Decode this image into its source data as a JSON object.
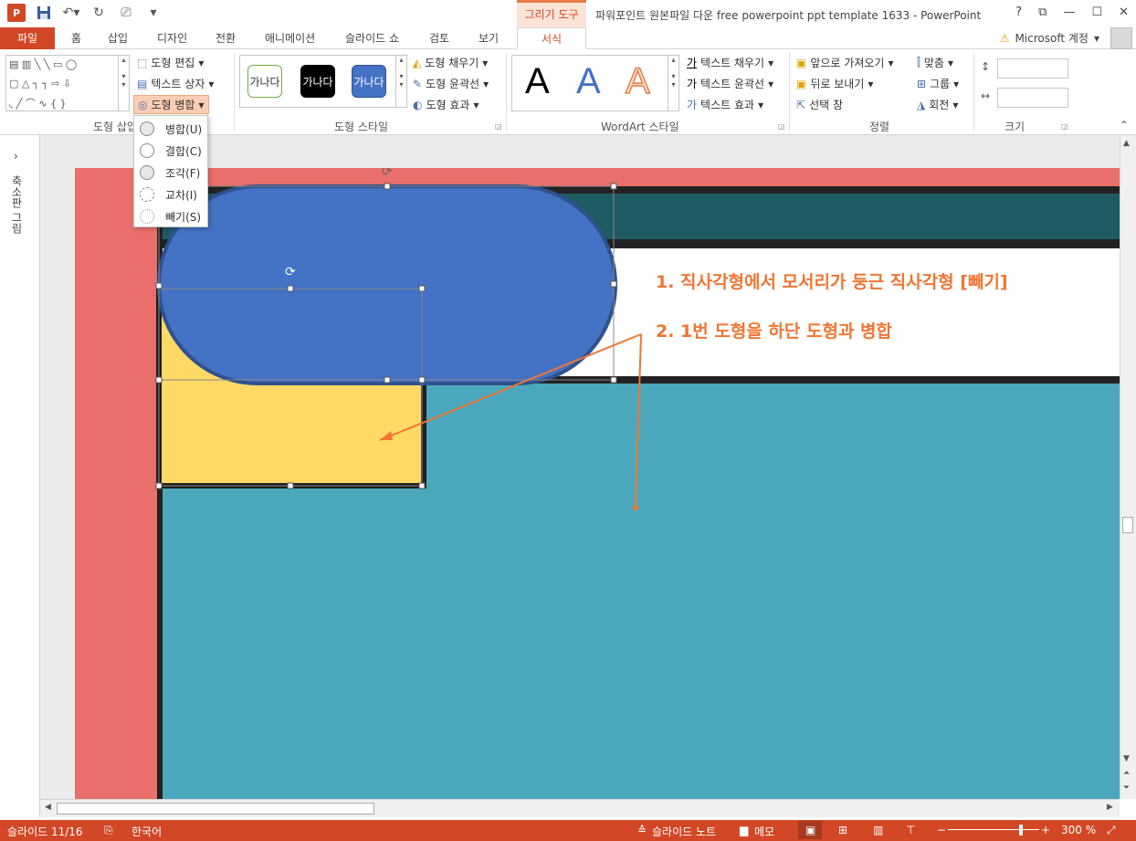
{
  "titlebar": {
    "drawing_tools": "그리기 도구",
    "window_title": "파워포인트 원본파일 다운 free powerpoint ppt template 1633 - PowerPoint",
    "help": "?",
    "restore": "⧉",
    "minimize": "—",
    "maximize": "☐",
    "close": "✕"
  },
  "tabs": {
    "file": "파일",
    "items": [
      "홈",
      "삽입",
      "디자인",
      "전환",
      "애니메이션",
      "슬라이드 쇼",
      "검토",
      "보기"
    ],
    "active": "서식",
    "account": "Microsoft 계정"
  },
  "ribbon": {
    "insert_shapes": {
      "label": "도형 삽입",
      "edit_shape": "도형 편집",
      "text_box": "텍스트 상자",
      "merge_shapes": "도형 병합"
    },
    "shape_styles": {
      "label": "도형 스타일",
      "preset_text": "가나다",
      "fill": "도형 채우기",
      "outline": "도형 윤곽선",
      "effects": "도형 효과"
    },
    "wordart": {
      "label": "WordArt 스타일",
      "letter": "A",
      "text_fill": "텍스트 채우기",
      "text_outline": "텍스트 윤곽선",
      "text_effects": "텍스트 효과"
    },
    "arrange": {
      "label": "정렬",
      "bring_forward": "앞으로 가져오기",
      "send_backward": "뒤로 보내기",
      "selection_pane": "선택 창",
      "align": "맞춤",
      "group": "그룹",
      "rotate": "회전"
    },
    "size": {
      "label": "크기"
    }
  },
  "merge_menu": {
    "items": [
      "병합(U)",
      "결합(C)",
      "조각(F)",
      "교차(I)",
      "빼기(S)"
    ]
  },
  "leftpane": {
    "collapsed_label": "축소판 그림"
  },
  "slide": {
    "annotation1": "1. 직사각형에서 모서리가 둥근 직사각형 [빼기]",
    "annotation2": "2. 1번 도형을 하단 도형과 병합"
  },
  "statusbar": {
    "slide_counter": "슬라이드 11/16",
    "language": "한국어",
    "notes": "슬라이드 노트",
    "comments": "메모",
    "zoom": "300 %"
  },
  "colors": {
    "accent": "#d24726",
    "slide_background": "#e86f6b",
    "pill_shape": "#4472c4",
    "yellow_shape": "#ffd966",
    "teal_area": "#4ba8bc",
    "dark_band": "#1f5b63",
    "annotation_text": "#f07532"
  }
}
